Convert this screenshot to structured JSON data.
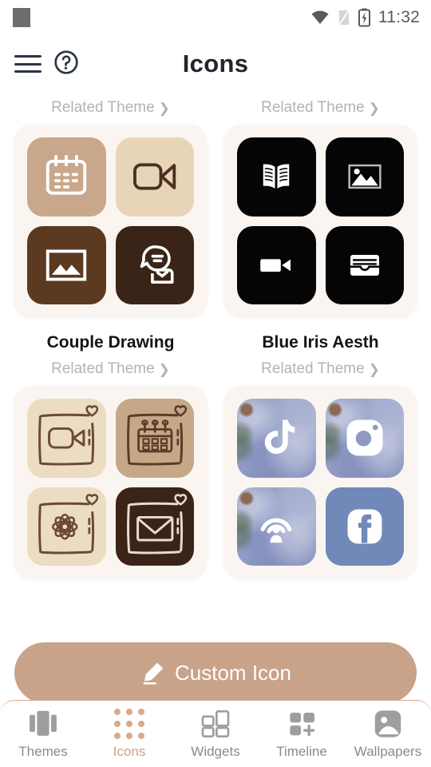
{
  "statusbar": {
    "time": "11:32",
    "icons": [
      "app-square-icon",
      "wifi-icon",
      "signal-icon",
      "battery-charging-icon"
    ]
  },
  "header": {
    "title": "Icons",
    "menu_icon": "hamburger-menu-icon",
    "help_icon": "help-circle-icon"
  },
  "cards": [
    {
      "related_label": "Related Theme",
      "title": "",
      "tiles": [
        {
          "icon": "calendar-icon",
          "bg": "#c9a78a",
          "fg": "#ffffff",
          "style": "outline"
        },
        {
          "icon": "video-camera-icon",
          "bg": "#e8d5b9",
          "fg": "#4a3222",
          "style": "outline"
        },
        {
          "icon": "gallery-icon",
          "bg": "#5c3a22",
          "fg": "#ffffff",
          "style": "outline"
        },
        {
          "icon": "chat-person-icon",
          "bg": "#3a2418",
          "fg": "#ffffff",
          "style": "outline"
        }
      ]
    },
    {
      "related_label": "Related Theme",
      "title": "",
      "tiles": [
        {
          "icon": "open-book-icon",
          "bg": "#050505",
          "fg": "#ffffff",
          "style": "solid"
        },
        {
          "icon": "gallery-icon",
          "bg": "#050505",
          "fg": "#ffffff",
          "style": "solid"
        },
        {
          "icon": "video-camera-icon",
          "bg": "#050505",
          "fg": "#ffffff",
          "style": "solid"
        },
        {
          "icon": "wallet-icon",
          "bg": "#050505",
          "fg": "#ffffff",
          "style": "solid"
        }
      ]
    },
    {
      "related_label": "Related Theme",
      "title": "Couple Drawing",
      "tiles": [
        {
          "icon": "video-camera-sketch-icon",
          "bg": "#ecdcc2",
          "fg": "#6b4a33",
          "style": "sketch"
        },
        {
          "icon": "calendar-sketch-icon",
          "bg": "#c6a888",
          "fg": "#5a3c28",
          "style": "sketch"
        },
        {
          "icon": "flower-sketch-icon",
          "bg": "#ecdcc2",
          "fg": "#6b4a33",
          "style": "sketch"
        },
        {
          "icon": "envelope-sketch-icon",
          "bg": "#3b2417",
          "fg": "#e8dcd0",
          "style": "sketch"
        }
      ]
    },
    {
      "related_label": "Related Theme",
      "title": "Blue Iris Aesth",
      "tiles": [
        {
          "icon": "tiktok-icon",
          "bg": "texture",
          "fg": "#ffffff",
          "style": "solid"
        },
        {
          "icon": "instagram-icon",
          "bg": "texture",
          "fg": "#ffffff",
          "style": "solid"
        },
        {
          "icon": "podcast-icon",
          "bg": "texture",
          "fg": "#ffffff",
          "style": "solid"
        },
        {
          "icon": "facebook-icon",
          "bg": "#7189b8",
          "fg": "#ffffff",
          "style": "solid"
        }
      ]
    }
  ],
  "custom_button": {
    "label": "Custom Icon",
    "icon": "pencil-icon",
    "bg": "#c9a28a"
  },
  "bottom_nav": {
    "active": "Icons",
    "accent": "#c9a28a",
    "items": [
      {
        "label": "Themes",
        "icon": "carousel-icon"
      },
      {
        "label": "Icons",
        "icon": "dot-grid-icon"
      },
      {
        "label": "Widgets",
        "icon": "widgets-squares-icon"
      },
      {
        "label": "Timeline",
        "icon": "timeline-plus-icon"
      },
      {
        "label": "Wallpapers",
        "icon": "wallpaper-image-icon"
      }
    ]
  }
}
